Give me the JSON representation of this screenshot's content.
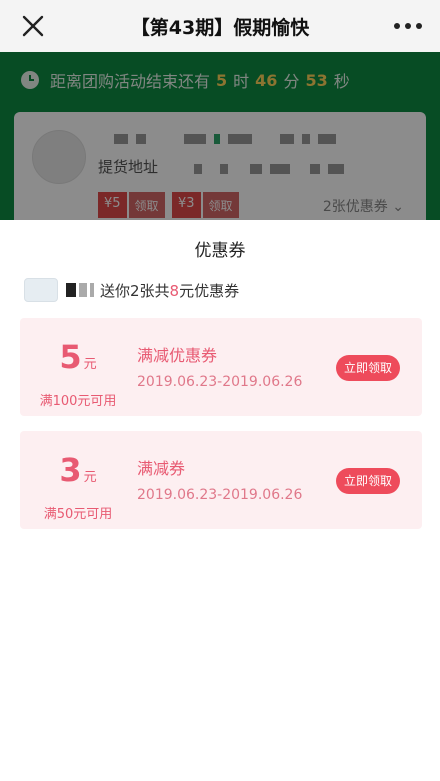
{
  "navbar": {
    "title": "【第43期】假期愉快"
  },
  "background": {
    "countdown": {
      "prefix": "距离团购活动结束还有",
      "hours": "5",
      "hours_unit": "时",
      "minutes": "46",
      "minutes_unit": "分",
      "seconds": "53",
      "seconds_unit": "秒"
    },
    "address_label": "提货地址",
    "coupons": [
      {
        "value": "¥5",
        "action": "领取"
      },
      {
        "value": "¥3",
        "action": "领取"
      }
    ],
    "more_coupons": "2张优惠券"
  },
  "sheet": {
    "title": "优惠券",
    "sender_text_pre": "送你2张共",
    "sender_text_amount": "8",
    "sender_text_post": "元优惠券",
    "coupons": [
      {
        "amount": "5",
        "unit": "元",
        "condition": "满100元可用",
        "name": "满减优惠券",
        "date_range": "2019.06.23-2019.06.26",
        "button": "立即领取"
      },
      {
        "amount": "3",
        "unit": "元",
        "condition": "满50元可用",
        "name": "满减券",
        "date_range": "2019.06.23-2019.06.26",
        "button": "立即领取"
      }
    ]
  },
  "colors": {
    "accent": "#e85a72",
    "button": "#ee4b5b",
    "coupon_bg": "#fdeff1",
    "header_green": "#0e8a43"
  }
}
